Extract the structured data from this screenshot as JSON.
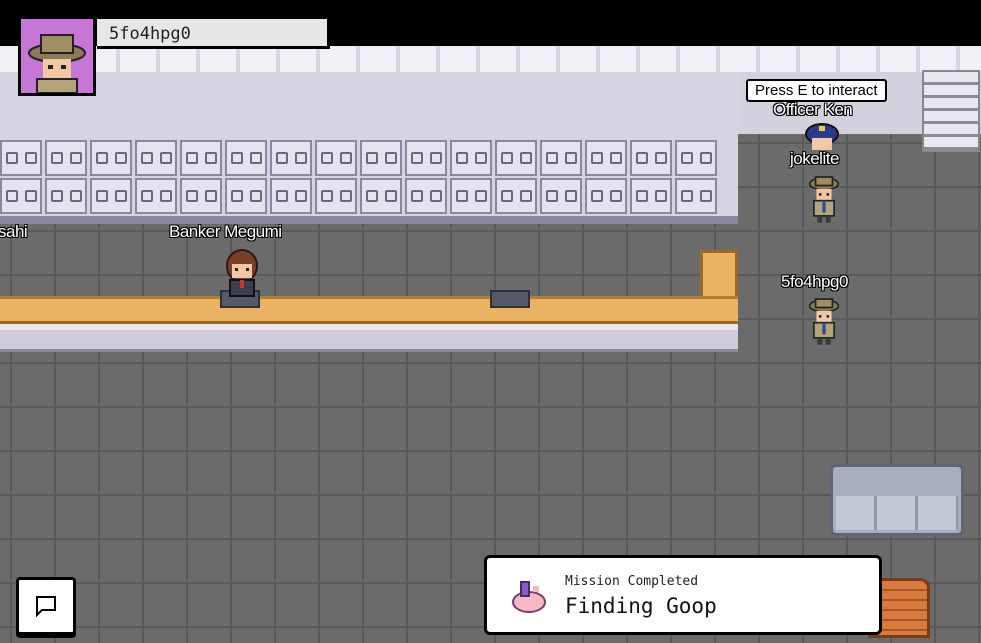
{
  "player": {
    "name": "5fo4hpg0",
    "avatar_icon": "detective-avatar-icon",
    "avatar_bg": "#c776d8"
  },
  "prompt": {
    "text": "Press E to interact"
  },
  "characters": {
    "officer": "Officer Ken",
    "jokelite": "jokelite",
    "player": "5fo4hpg0",
    "banker": "Banker Megumi",
    "partial": "sahi"
  },
  "chat": {
    "icon": "chat-bubble-icon"
  },
  "mission": {
    "label": "Mission Completed",
    "title": "Finding Goop",
    "icon": "goop-creature-icon"
  },
  "colors": {
    "floor": "#6b6b6b",
    "counter": "#e8b463",
    "vault": "#d8d3e2"
  }
}
